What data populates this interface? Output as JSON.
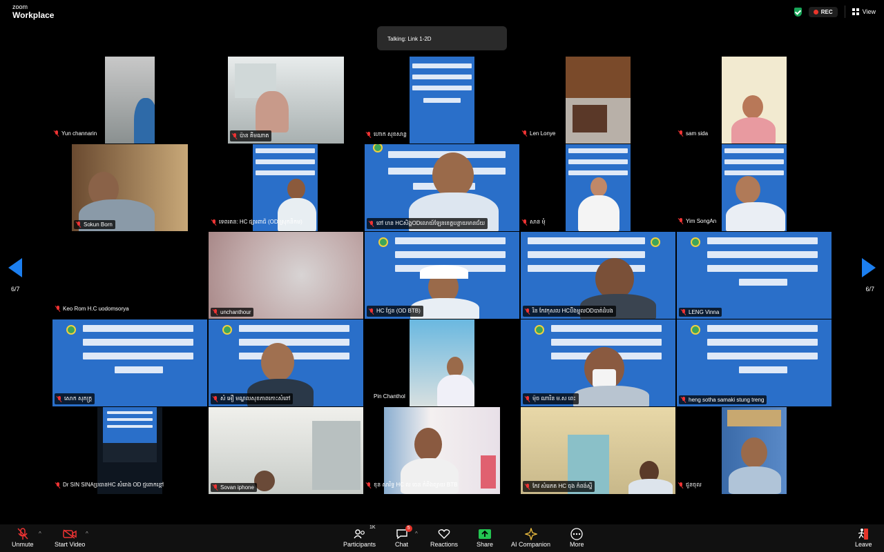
{
  "app": {
    "brand_small": "zoom",
    "brand_big": "Workplace"
  },
  "top": {
    "rec": "REC",
    "view": "View"
  },
  "talking": "Talking: Link 1-2D",
  "pager": {
    "left": "6/7",
    "right": "6/7"
  },
  "participants": [
    {
      "name": "Yun channarin"
    },
    {
      "name": "ប៉ាន គីមណាត"
    },
    {
      "name": "ហោក សុខសាន្ត"
    },
    {
      "name": "Len Lonye"
    },
    {
      "name": "sam sida"
    },
    {
      "name": "Sokun Born"
    },
    {
      "name": "ទេពរតន: HC ផ្សារពាជ៍ (OD ស្រុកនិកម)"
    },
    {
      "name": "ពៅ ហន HCសិង្ហODលោយ៍ឡែនខេត្តបន្ទាយមានជ័យ"
    },
    {
      "name": "សាន មុំ"
    },
    {
      "name": "Yim SongAn"
    },
    {
      "name": "Keo Rom H.C uodomsorya"
    },
    {
      "name": "unchanthour"
    },
    {
      "name": "HC ថ្មែន (OD BTB)"
    },
    {
      "name": "រិន កែវកុសល HCបឹងម្ចុលODបាត់ដំបង"
    },
    {
      "name": "LENG Vinna"
    },
    {
      "name": "សោក សុភក្រ្ត"
    },
    {
      "name": "សំ អឿ មណ្ឌលសុខភាពកោះសំពៅ"
    },
    {
      "name": "Pin Chanthol"
    },
    {
      "name": "ម៉ុច ណារិន ម.ស ពេះ"
    },
    {
      "name": "heng sotha samaki stung treng"
    },
    {
      "name": "Dr SIN SINAប្រធានHC សំរោង OD ថ្មពោកខ្ពៅ"
    },
    {
      "name": "Sovan iphone"
    },
    {
      "name": "ខុន សារិទ្ធ HC ល ចេន កំពីងព្យាយ BTB"
    },
    {
      "name": "កែវ សំរេភត HC ចុង កំពង់ស្នី"
    },
    {
      "name": "ជួនចុល"
    }
  ],
  "toolbar": {
    "unmute": "Unmute",
    "start_video": "Start Video",
    "participants": "Participants",
    "participants_count": "1K",
    "chat": "Chat",
    "chat_badge": "5",
    "reactions": "Reactions",
    "share": "Share",
    "ai": "AI Companion",
    "more": "More",
    "leave": "Leave"
  },
  "colors": {
    "accent": "#1c7ff0",
    "share_green": "#23c552",
    "slide_blue": "#2a6fc9",
    "mute_red": "#e33333"
  }
}
